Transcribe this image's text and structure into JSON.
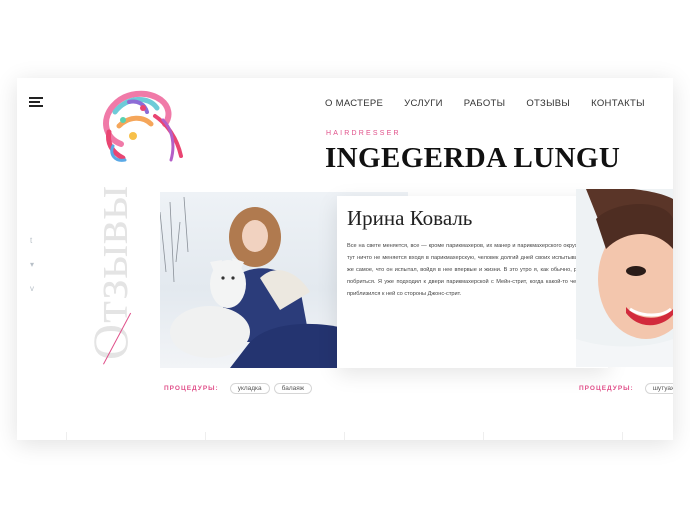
{
  "nav": {
    "items": [
      "О МАСТЕРЕ",
      "УСЛУГИ",
      "РАБОТЫ",
      "ОТЗЫВЫ",
      "КОНТАКТЫ"
    ]
  },
  "hero": {
    "subtitle": "HAIRDRESSER",
    "name": "INGEGERDA LUNGU"
  },
  "section": {
    "vertical_title": "Отзывы"
  },
  "social": [
    "t",
    "▾",
    "v"
  ],
  "review": {
    "name": "Ирина Коваль",
    "text": "Все на свете меняется, все — кроме парикмахеров, их манер и парикмахерского окружения тут ничто не меняется входя в парикмахерскую, человек долгий дней своих испытывает то же самое, что он испытал, войдя в нее впервые и жизни. В это утро я, как обычно, решил побриться. Я уже подходил к двери парикмахерской с Мейн-стрит, когда какой-то человек приблизился к ней со стороны Джонс-стрит."
  },
  "procedures": {
    "label": "ПРОЦЕДУРЫ:",
    "tags": [
      "укладка",
      "балаяж"
    ]
  },
  "procedures2": {
    "label": "ПРОЦЕДУРЫ:",
    "tags": [
      "шутуаж"
    ]
  },
  "colors": {
    "accent": "#e0508a",
    "text": "#111111",
    "muted": "#e4e4e4"
  }
}
